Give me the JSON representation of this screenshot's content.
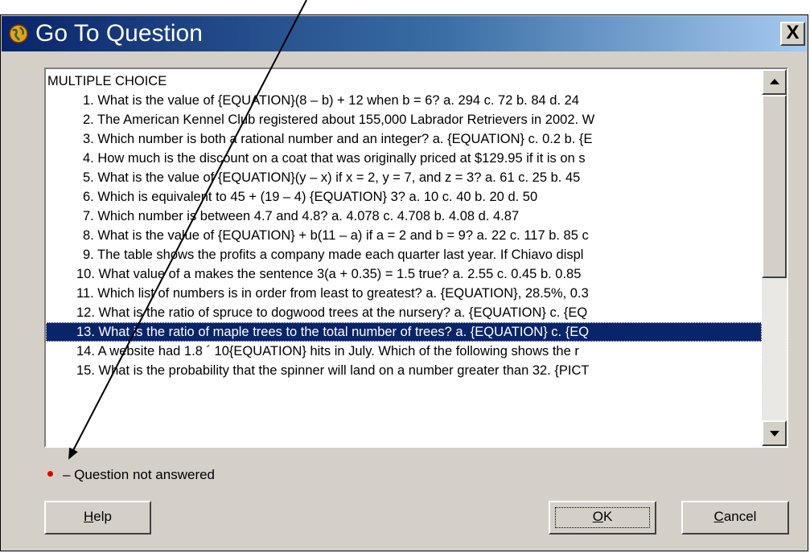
{
  "dialog": {
    "title": "Go To Question",
    "close_label": "X"
  },
  "list": {
    "heading": "MULTIPLE CHOICE",
    "items": [
      "1. What is the value of {EQUATION}(8 – b) + 12 when b = 6? a. 294 c. 72  b. 84 d. 24",
      "2. The American Kennel Club registered about 155,000 Labrador Retrievers in 2002. W",
      "3. Which number is both a rational number and an integer? a. {EQUATION} c. 0.2  b. {E",
      "4. How much is the discount on a coat that was originally priced at $129.95 if it is on s",
      "5. What is the value of {EQUATION}(y – x) if x = 2, y = 7, and z = 3? a. 61 c. 25  b. 45",
      "6. Which is equivalent to 45 + (19 – 4) {EQUATION} 3? a. 10 c. 40  b. 20 d. 50",
      "7. Which number is between 4.7 and 4.8? a. 4.078 c. 4.708  b. 4.08 d. 4.87",
      "8. What is the value of {EQUATION} + b(11 – a) if a = 2 and b = 9? a. 22 c. 117  b. 85 c",
      "9. The table shows the profits a company made each quarter last year. If Chiavo displ",
      "10. What value of a makes the sentence 3(a + 0.35) = 1.5 true? a. 2.55 c. 0.45  b. 0.85",
      "11. Which list of numbers is in order from least to greatest? a. {EQUATION}, 28.5%, 0.3",
      "12. What is the ratio of spruce to dogwood trees at the nursery? a. {EQUATION} c. {EQ",
      "13. What is the ratio of maple trees to the total number of trees? a. {EQUATION} c. {EQ",
      "14. A website had 1.8 ´ 10{EQUATION} hits in July. Which of the following shows the r",
      "15. What is the probability that the spinner will land on a number greater than 32. {PICT"
    ],
    "selected_index": 12
  },
  "legend": {
    "text": "– Question not answered"
  },
  "buttons": {
    "help": {
      "mnemonic": "H",
      "rest": "elp"
    },
    "ok": {
      "mnemonic": "O",
      "rest": "K"
    },
    "cancel": {
      "mnemonic": "C",
      "rest": "ancel"
    }
  },
  "colors": {
    "selection": "#0a246a",
    "unanswered_dot": "#e00000",
    "dialog_face": "#d4d0c8"
  }
}
